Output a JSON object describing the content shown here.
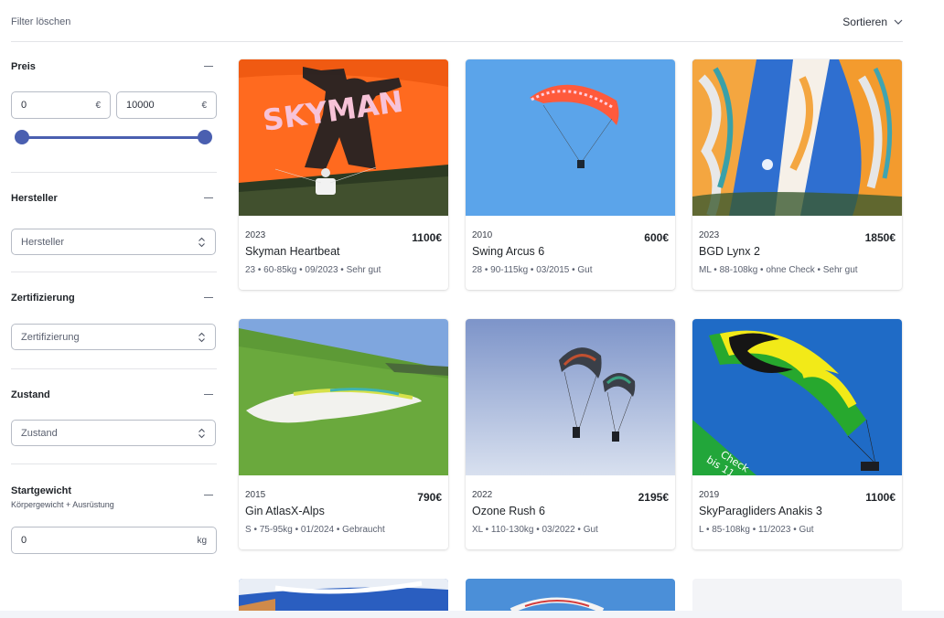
{
  "topbar": {
    "clear_filter": "Filter löschen",
    "sort_label": "Sortieren"
  },
  "filters": {
    "price": {
      "title": "Preis",
      "min_value": "0",
      "max_value": "10000",
      "currency": "€",
      "range_min": 0,
      "range_max": 10000
    },
    "manufacturer": {
      "title": "Hersteller",
      "placeholder": "Hersteller"
    },
    "certification": {
      "title": "Zertifizierung",
      "placeholder": "Zertifizierung"
    },
    "condition": {
      "title": "Zustand",
      "placeholder": "Zustand"
    },
    "weight": {
      "title": "Startgewicht",
      "subtitle": "Körpergewicht + Ausrüstung",
      "value": "0",
      "unit": "kg"
    }
  },
  "listings": [
    {
      "year": "2023",
      "name": "Skyman Heartbeat",
      "price": "1100€",
      "specs": "23 • 60-85kg • 09/2023 • Sehr gut",
      "image_text": "SKYMAN"
    },
    {
      "year": "2010",
      "name": "Swing Arcus 6",
      "price": "600€",
      "specs": "28 • 90-115kg • 03/2015 • Gut"
    },
    {
      "year": "2023",
      "name": "BGD Lynx 2",
      "price": "1850€",
      "specs": "ML • 88-108kg • ohne Check • Sehr gut"
    },
    {
      "year": "2015",
      "name": "Gin AtlasX-Alps",
      "price": "790€",
      "specs": "S • 75-95kg • 01/2024 • Gebraucht"
    },
    {
      "year": "2022",
      "name": "Ozone Rush 6",
      "price": "2195€",
      "specs": "XL • 110-130kg • 03/2022 • Gut"
    },
    {
      "year": "2019",
      "name": "SkyParagliders Anakis 3",
      "price": "1100€",
      "specs": "L • 85-108kg • 11/2023 • Gut",
      "image_text": "Check\nbis 11"
    }
  ],
  "colors": {
    "accent": "#4a5fb0",
    "border": "#b7bcc6",
    "divider": "#e3e4e8"
  }
}
